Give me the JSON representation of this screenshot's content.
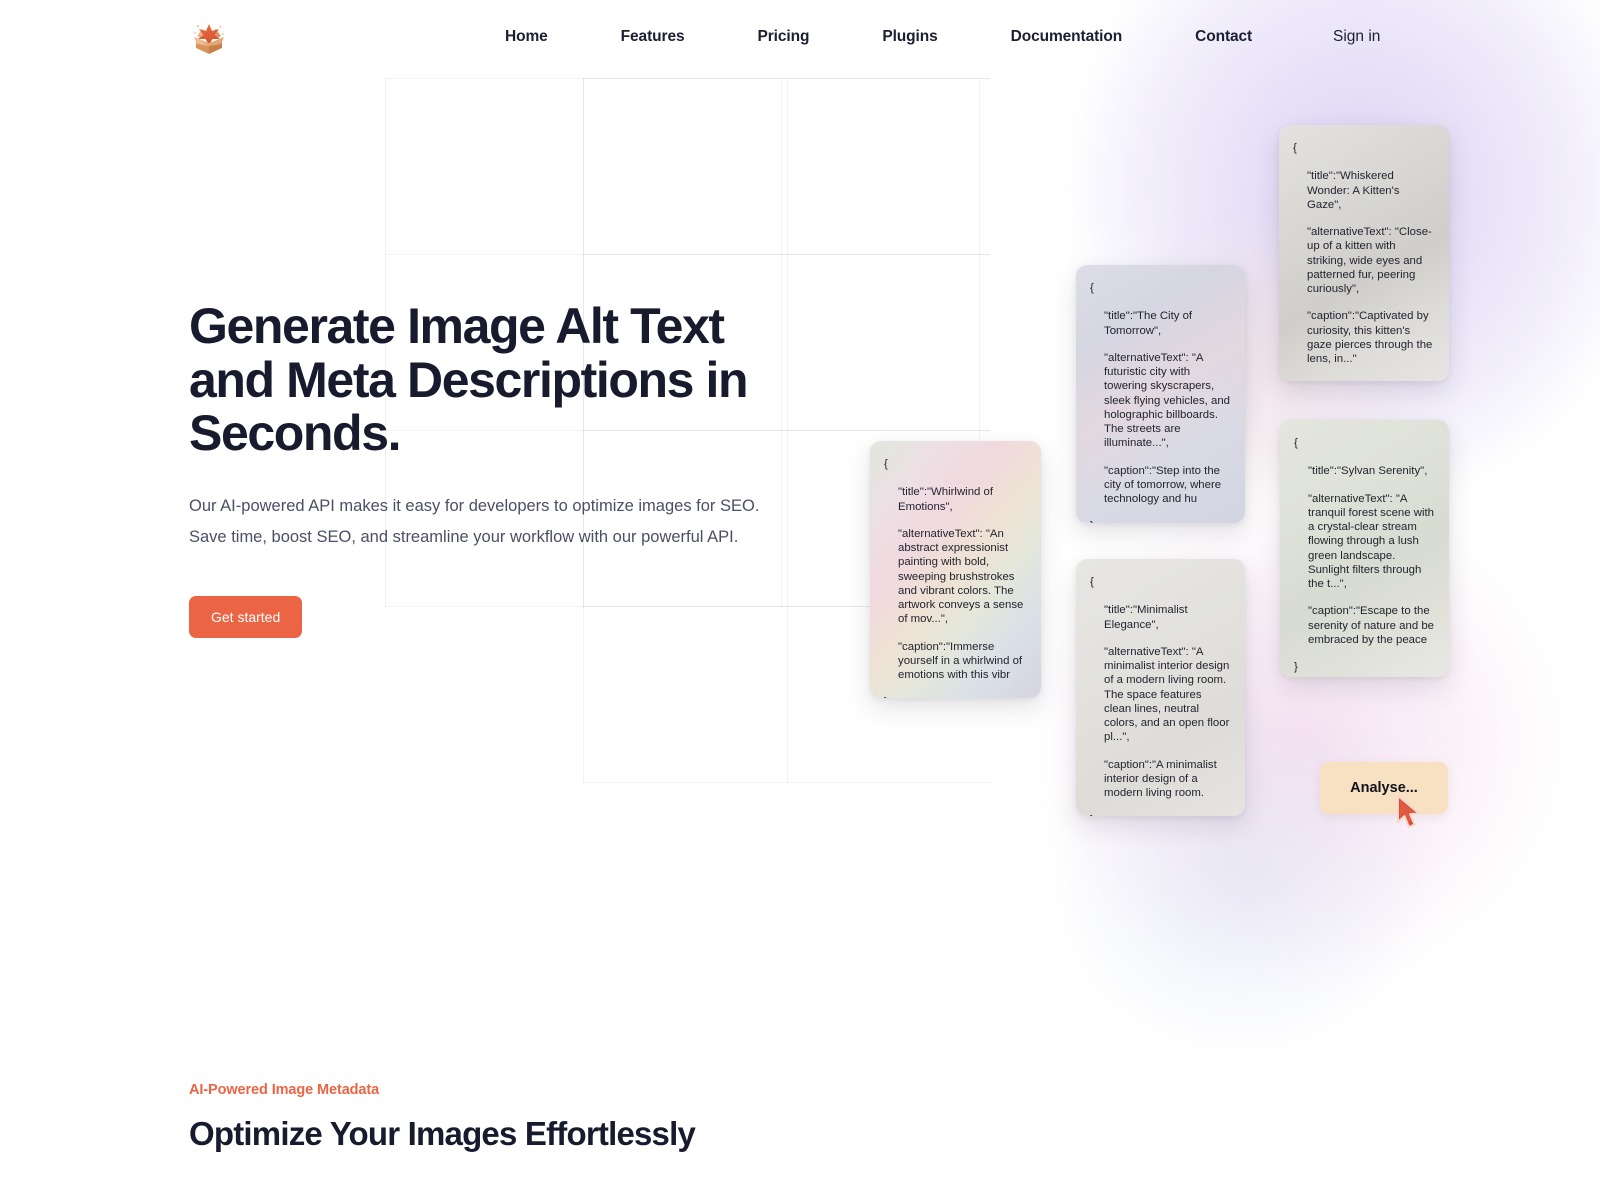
{
  "header": {
    "logo_icon": "open-box-icon",
    "nav": [
      {
        "label": "Home"
      },
      {
        "label": "Features"
      },
      {
        "label": "Pricing"
      },
      {
        "label": "Plugins"
      },
      {
        "label": "Documentation"
      },
      {
        "label": "Contact"
      }
    ],
    "signin_label": "Sign in"
  },
  "hero": {
    "title": "Generate Image Alt Text and Meta Descriptions in Seconds.",
    "subtitle": "Our AI-powered API makes it easy for developers to optimize images for SEO. Save time, boost SEO, and streamline your workflow with our powerful API.",
    "cta_label": "Get started"
  },
  "cards": [
    {
      "id": "kitten",
      "open_brace": "{",
      "title_line": "\"title\":\"Whiskered Wonder: A Kitten's Gaze\",",
      "alt_line": "\"alternativeText\": \"Close-up of a kitten with striking, wide eyes and patterned fur, peering curiously\",",
      "caption_line": "\"caption\":\"Captivated by curiosity, this kitten's gaze pierces through the lens, in...\"",
      "close_brace": "}"
    },
    {
      "id": "city",
      "open_brace": "{",
      "title_line": "\"title\":\"The City of Tomorrow\",",
      "alt_line": "\"alternativeText\": \"A futuristic city with towering skyscrapers, sleek flying vehicles, and holographic billboards. The streets are illuminate...\",",
      "caption_line": "\"caption\":\"Step into the city of tomorrow, where technology and hu",
      "close_brace": "}"
    },
    {
      "id": "whirlwind",
      "open_brace": "{",
      "title_line": "\"title\":\"Whirlwind of Emotions\",",
      "alt_line": "\"alternativeText\": \"An abstract expressionist painting with bold, sweeping brushstrokes and vibrant colors. The artwork conveys a sense of mov...\",",
      "caption_line": "\"caption\":\"Immerse yourself in a whirlwind of emotions with this vibr",
      "close_brace": "}"
    },
    {
      "id": "minimal",
      "open_brace": "{",
      "title_line": "\"title\":\"Minimalist Elegance\",",
      "alt_line": "\"alternativeText\": \"A minimalist interior design of a modern living room. The space features clean lines, neutral colors, and an open floor pl...\",",
      "caption_line": "\"caption\":\"A minimalist interior design of a modern living room.",
      "close_brace": "}"
    },
    {
      "id": "sylvan",
      "open_brace": "{",
      "title_line": "\"title\":\"Sylvan Serenity\",",
      "alt_line": "\"alternativeText\": \"A tranquil forest scene with a crystal-clear stream flowing through a lush green landscape. Sunlight filters through the t...\",",
      "caption_line": "\"caption\":\"Escape to the serenity of nature and be embraced by the peace",
      "close_brace": "}"
    }
  ],
  "analyse": {
    "label": "Analyse...",
    "cursor_icon": "mouse-pointer-icon"
  },
  "lower": {
    "eyebrow": "AI-Powered Image Metadata",
    "title": "Optimize Your Images Effortlessly"
  },
  "colors": {
    "accent_orange": "#eb6545",
    "heading_navy": "#181a2e",
    "body_gray": "#4b4f66",
    "analyse_peach": "#f8e0c3",
    "background": "#ffffff"
  }
}
